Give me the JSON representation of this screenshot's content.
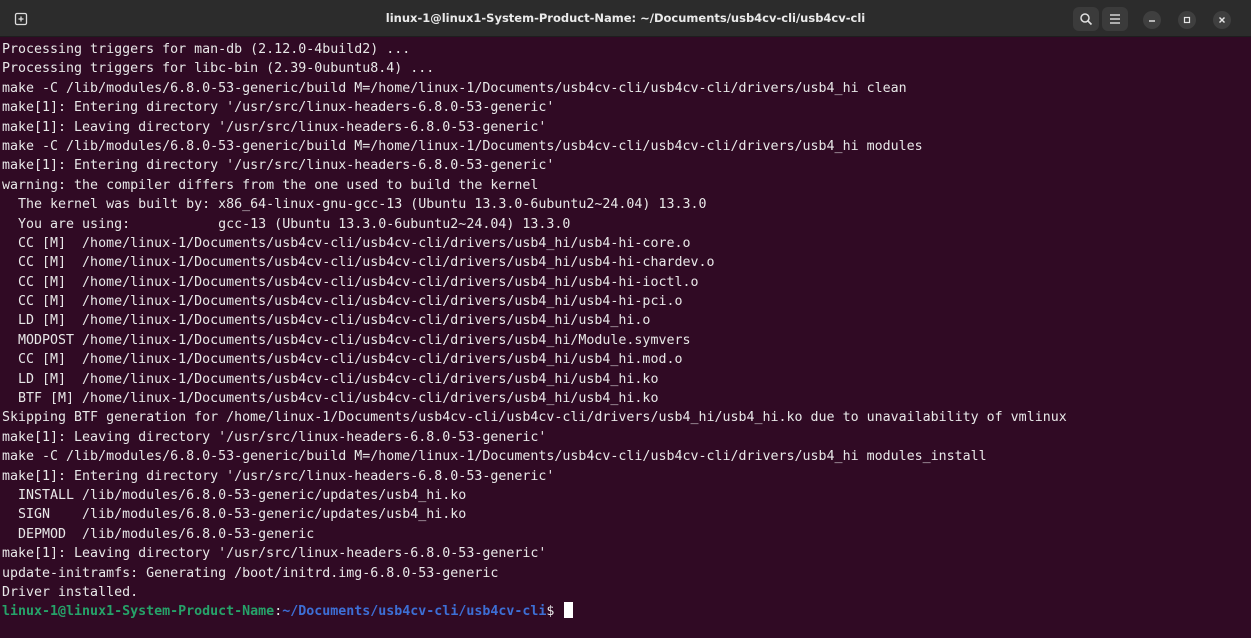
{
  "window": {
    "title": "linux-1@linux1-System-Product-Name: ~/Documents/usb4cv-cli/usb4cv-cli"
  },
  "titlebar": {
    "buttons": [
      {
        "name": "new-tab",
        "icon": "new-tab-icon"
      },
      {
        "name": "search",
        "icon": "search-icon"
      },
      {
        "name": "menu",
        "icon": "hamburger-menu-icon"
      },
      {
        "name": "minimize",
        "icon": "minimize-icon"
      },
      {
        "name": "maximize",
        "icon": "maximize-icon"
      },
      {
        "name": "close",
        "icon": "close-icon"
      }
    ]
  },
  "terminal": {
    "lines": [
      "Processing triggers for man-db (2.12.0-4build2) ...",
      "Processing triggers for libc-bin (2.39-0ubuntu8.4) ...",
      "make -C /lib/modules/6.8.0-53-generic/build M=/home/linux-1/Documents/usb4cv-cli/usb4cv-cli/drivers/usb4_hi clean",
      "make[1]: Entering directory '/usr/src/linux-headers-6.8.0-53-generic'",
      "make[1]: Leaving directory '/usr/src/linux-headers-6.8.0-53-generic'",
      "make -C /lib/modules/6.8.0-53-generic/build M=/home/linux-1/Documents/usb4cv-cli/usb4cv-cli/drivers/usb4_hi modules",
      "make[1]: Entering directory '/usr/src/linux-headers-6.8.0-53-generic'",
      "warning: the compiler differs from the one used to build the kernel",
      "  The kernel was built by: x86_64-linux-gnu-gcc-13 (Ubuntu 13.3.0-6ubuntu2~24.04) 13.3.0",
      "  You are using:           gcc-13 (Ubuntu 13.3.0-6ubuntu2~24.04) 13.3.0",
      "  CC [M]  /home/linux-1/Documents/usb4cv-cli/usb4cv-cli/drivers/usb4_hi/usb4-hi-core.o",
      "  CC [M]  /home/linux-1/Documents/usb4cv-cli/usb4cv-cli/drivers/usb4_hi/usb4-hi-chardev.o",
      "  CC [M]  /home/linux-1/Documents/usb4cv-cli/usb4cv-cli/drivers/usb4_hi/usb4-hi-ioctl.o",
      "  CC [M]  /home/linux-1/Documents/usb4cv-cli/usb4cv-cli/drivers/usb4_hi/usb4-hi-pci.o",
      "  LD [M]  /home/linux-1/Documents/usb4cv-cli/usb4cv-cli/drivers/usb4_hi/usb4_hi.o",
      "  MODPOST /home/linux-1/Documents/usb4cv-cli/usb4cv-cli/drivers/usb4_hi/Module.symvers",
      "  CC [M]  /home/linux-1/Documents/usb4cv-cli/usb4cv-cli/drivers/usb4_hi/usb4_hi.mod.o",
      "  LD [M]  /home/linux-1/Documents/usb4cv-cli/usb4cv-cli/drivers/usb4_hi/usb4_hi.ko",
      "  BTF [M] /home/linux-1/Documents/usb4cv-cli/usb4cv-cli/drivers/usb4_hi/usb4_hi.ko",
      "Skipping BTF generation for /home/linux-1/Documents/usb4cv-cli/usb4cv-cli/drivers/usb4_hi/usb4_hi.ko due to unavailability of vmlinux",
      "make[1]: Leaving directory '/usr/src/linux-headers-6.8.0-53-generic'",
      "make -C /lib/modules/6.8.0-53-generic/build M=/home/linux-1/Documents/usb4cv-cli/usb4cv-cli/drivers/usb4_hi modules_install",
      "make[1]: Entering directory '/usr/src/linux-headers-6.8.0-53-generic'",
      "  INSTALL /lib/modules/6.8.0-53-generic/updates/usb4_hi.ko",
      "  SIGN    /lib/modules/6.8.0-53-generic/updates/usb4_hi.ko",
      "  DEPMOD  /lib/modules/6.8.0-53-generic",
      "make[1]: Leaving directory '/usr/src/linux-headers-6.8.0-53-generic'",
      "update-initramfs: Generating /boot/initrd.img-6.8.0-53-generic",
      "Driver installed."
    ],
    "prompt": {
      "user_host": "linux-1@linux1-System-Product-Name",
      "colon": ":",
      "path": "~/Documents/usb4cv-cli/usb4cv-cli",
      "symbol": "$ "
    }
  },
  "colors": {
    "terminal_background": "#300a24",
    "text": "#e8e8e8",
    "prompt_user": "#26a269",
    "prompt_path": "#3d6fd6",
    "titlebar": "#2c2c2c"
  }
}
